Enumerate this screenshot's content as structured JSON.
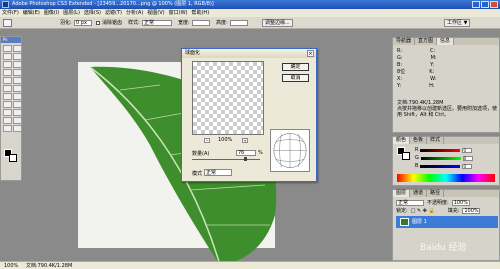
{
  "titlebar": {
    "title": "Adobe Photoshop CS3 Extended - [23459...20170...png @ 100% (图层 1, RGB/8)]"
  },
  "menubar": [
    "文件(F)",
    "编辑(E)",
    "图像(I)",
    "图层(L)",
    "选择(S)",
    "滤镜(T)",
    "分析(A)",
    "视图(V)",
    "窗口(W)",
    "帮助(H)"
  ],
  "optionsbar": {
    "feather_label": "羽化:",
    "feather_value": "0 px",
    "antialias_label": "消除锯齿",
    "style_label": "样式:",
    "style_value": "正常",
    "width_label": "宽度:",
    "height_label": "高度:",
    "refine_label": "调整边缘...",
    "workspace_label": "工作区 ▼"
  },
  "toolbox": {
    "header": "Ps"
  },
  "dialog": {
    "title": "球面化",
    "ok": "确定",
    "cancel": "取消",
    "zoom_value": "100%",
    "amount_label": "数量(A)",
    "amount_value": "76",
    "amount_unit": "%",
    "mode_label": "模式",
    "mode_value": "正常",
    "amount_fraction": 0.76
  },
  "navpanel": {
    "tabs": [
      "导航器",
      "直方图",
      "信息"
    ],
    "rows": [
      [
        "R:",
        "C:"
      ],
      [
        "G:",
        "M:"
      ],
      [
        "B:",
        "Y:"
      ],
      [
        "8位",
        "K:"
      ],
      [
        "X:",
        "W:"
      ],
      [
        "Y:",
        "H:"
      ]
    ],
    "doc_size": "文档:790.4K/1.28M",
    "hint": "点按并拖移以创建新选区。要用附加选项，使用 Shift，Alt 和 Ctrl。"
  },
  "colorpanel": {
    "tabs": [
      "颜色",
      "色板",
      "样式"
    ],
    "channels": [
      {
        "label": "R",
        "value": "0"
      },
      {
        "label": "G",
        "value": "0"
      },
      {
        "label": "B",
        "value": "0"
      }
    ]
  },
  "layerspanel": {
    "tabs": [
      "图层",
      "通道",
      "路径"
    ],
    "blend_mode": "正常",
    "opacity_label": "不透明度:",
    "opacity_value": "100%",
    "lock_label": "锁定:",
    "fill_label": "填充:",
    "fill_value": "100%",
    "layer_name": "图层 1"
  },
  "watermark": "Baidu 经验",
  "statusbar": {
    "zoom": "100%",
    "doc": "文档:790.4K/1.28M"
  }
}
